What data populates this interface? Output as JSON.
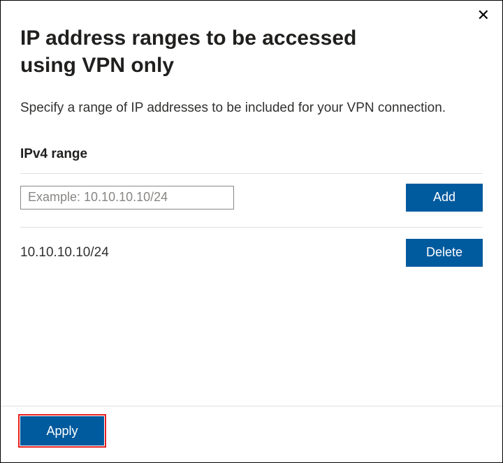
{
  "dialog": {
    "title": "IP address ranges to be accessed using VPN only",
    "description": "Specify a range of IP addresses to be included for your VPN connection.",
    "close_symbol": "✕"
  },
  "ipv4": {
    "section_label": "IPv4 range",
    "input_placeholder": "Example: 10.10.10.10/24",
    "input_value": "",
    "add_button_label": "Add",
    "entries": [
      {
        "value": "10.10.10.10/24",
        "delete_label": "Delete"
      }
    ]
  },
  "footer": {
    "apply_label": "Apply"
  },
  "colors": {
    "primary_button": "#005a9e",
    "highlight_outline": "#e62020"
  }
}
